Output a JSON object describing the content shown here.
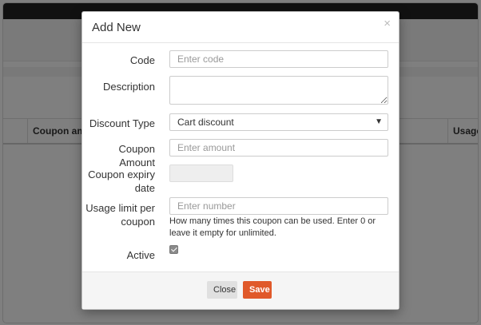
{
  "background": {
    "table_headers": [
      "Coupon amou",
      "Usage"
    ]
  },
  "modal": {
    "title": "Add New",
    "close_icon": "×",
    "fields": {
      "code": {
        "label": "Code",
        "placeholder": "Enter code",
        "value": ""
      },
      "description": {
        "label": "Description",
        "value": ""
      },
      "discount_type": {
        "label": "Discount Type",
        "selected": "Cart discount"
      },
      "coupon_amount": {
        "label": "Coupon Amount",
        "placeholder": "Enter amount",
        "value": ""
      },
      "coupon_expiry": {
        "label": "Coupon expiry date",
        "value": ""
      },
      "usage_limit": {
        "label": "Usage limit per coupon",
        "placeholder": "Enter number",
        "help": "How many times this coupon can be used. Enter 0 or leave it empty for unlimited."
      },
      "active": {
        "label": "Active",
        "checked": true
      }
    },
    "footer": {
      "close_label": "Close",
      "save_label": "Save"
    }
  },
  "colors": {
    "save_button": "#e0592a",
    "overlay": "rgba(0,0,0,0.5)"
  }
}
